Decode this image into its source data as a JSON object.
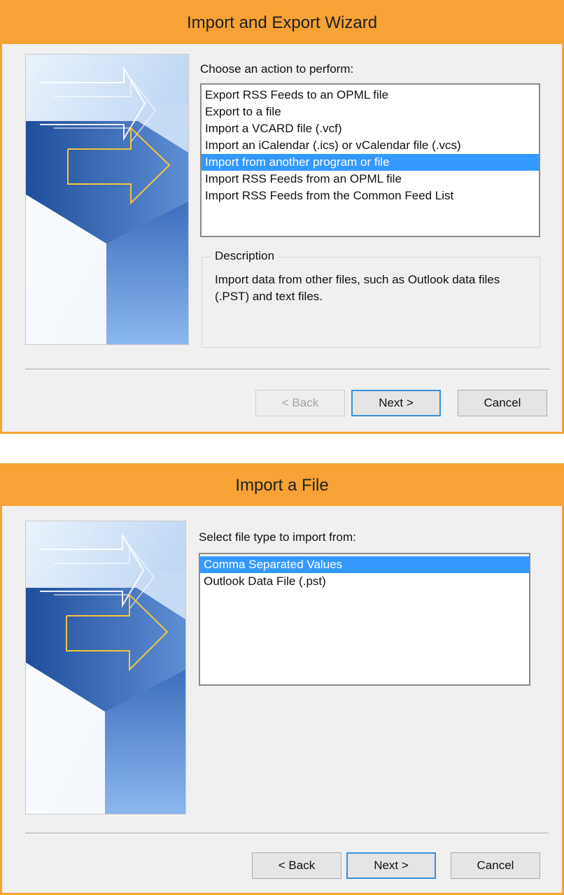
{
  "dialog1": {
    "title": "Import and Export Wizard",
    "prompt": "Choose an action to perform:",
    "actions": [
      "Export RSS Feeds to an OPML file",
      "Export to a file",
      "Import a VCARD file (.vcf)",
      "Import an iCalendar (.ics) or vCalendar file (.vcs)",
      "Import from another program or file",
      "Import RSS Feeds from an OPML file",
      "Import RSS Feeds from the Common Feed List"
    ],
    "selected_index": 4,
    "description": {
      "legend": "Description",
      "text": "Import data from other files, such as Outlook data files (.PST) and text files."
    },
    "buttons": {
      "back": "< Back",
      "next": "Next >",
      "cancel": "Cancel"
    }
  },
  "dialog2": {
    "title": "Import a File",
    "prompt": "Select file type to import from:",
    "file_types": [
      "Comma Separated Values",
      "Outlook Data File (.pst)"
    ],
    "selected_index": 0,
    "buttons": {
      "back": "< Back",
      "next": "Next >",
      "cancel": "Cancel"
    }
  },
  "colors": {
    "titlebar": "#f7a234",
    "selection": "#3399ff",
    "dialog_bg": "#f0f0f0"
  },
  "icons": {
    "wizard_art": "wizard-arrows-image"
  }
}
